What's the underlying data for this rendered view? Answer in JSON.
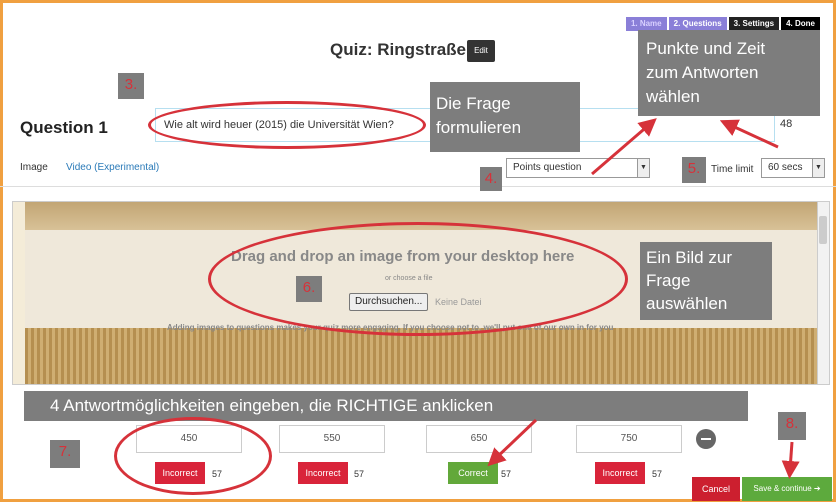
{
  "steps": [
    "1. Name",
    "2. Questions",
    "3. Settings",
    "4. Done"
  ],
  "quiz_title": "Quiz: Ringstraße",
  "edit_label": "Edit",
  "question": {
    "label": "Question 1",
    "text": "Wie alt wird heuer (2015) die Universität Wien?",
    "chars_left": "48"
  },
  "tabs": [
    "Image",
    "Video (Experimental)"
  ],
  "points_select": "Points question",
  "time_label": "Time limit",
  "time_select": "60 secs",
  "image_area": {
    "drag_text": "Drag and drop an image from your desktop here",
    "or_text": "or choose a file",
    "browse_label": "Durchsuchen...",
    "no_file": "Keine Datei",
    "hint": "Adding images to questions makes your quiz more engaging. If you choose not to, we'll put one of our own in for you"
  },
  "answers": [
    {
      "value": "450",
      "status": "Incorrect",
      "count": "57"
    },
    {
      "value": "550",
      "status": "Incorrect",
      "count": "57"
    },
    {
      "value": "650",
      "status": "Correct",
      "count": "57"
    },
    {
      "value": "750",
      "status": "Incorrect",
      "count": "57"
    }
  ],
  "cancel_label": "Cancel",
  "save_label": "Save & continue ➔",
  "annotations": {
    "n3": "3.",
    "n4": "4.",
    "n5": "5.",
    "n6": "6.",
    "n7": "7.",
    "n8": "8.",
    "frage_line1": "Die Frage",
    "frage_line2": "formulieren",
    "punkte_line1": "Punkte und Zeit",
    "punkte_line2": "zum Antworten",
    "punkte_line3": "wählen",
    "bild_line1": "Ein Bild zur",
    "bild_line2": "Frage",
    "bild_line3": "auswählen",
    "antwort": "4 Antwortmöglichkeiten eingeben, die RICHTIGE anklicken"
  },
  "colors": {
    "accent_red": "#d6323a",
    "callout_gray": "#7d7d7d",
    "correct_green": "#62a83a",
    "incorrect_red": "#d9243a",
    "frame_orange": "#f0a040"
  }
}
